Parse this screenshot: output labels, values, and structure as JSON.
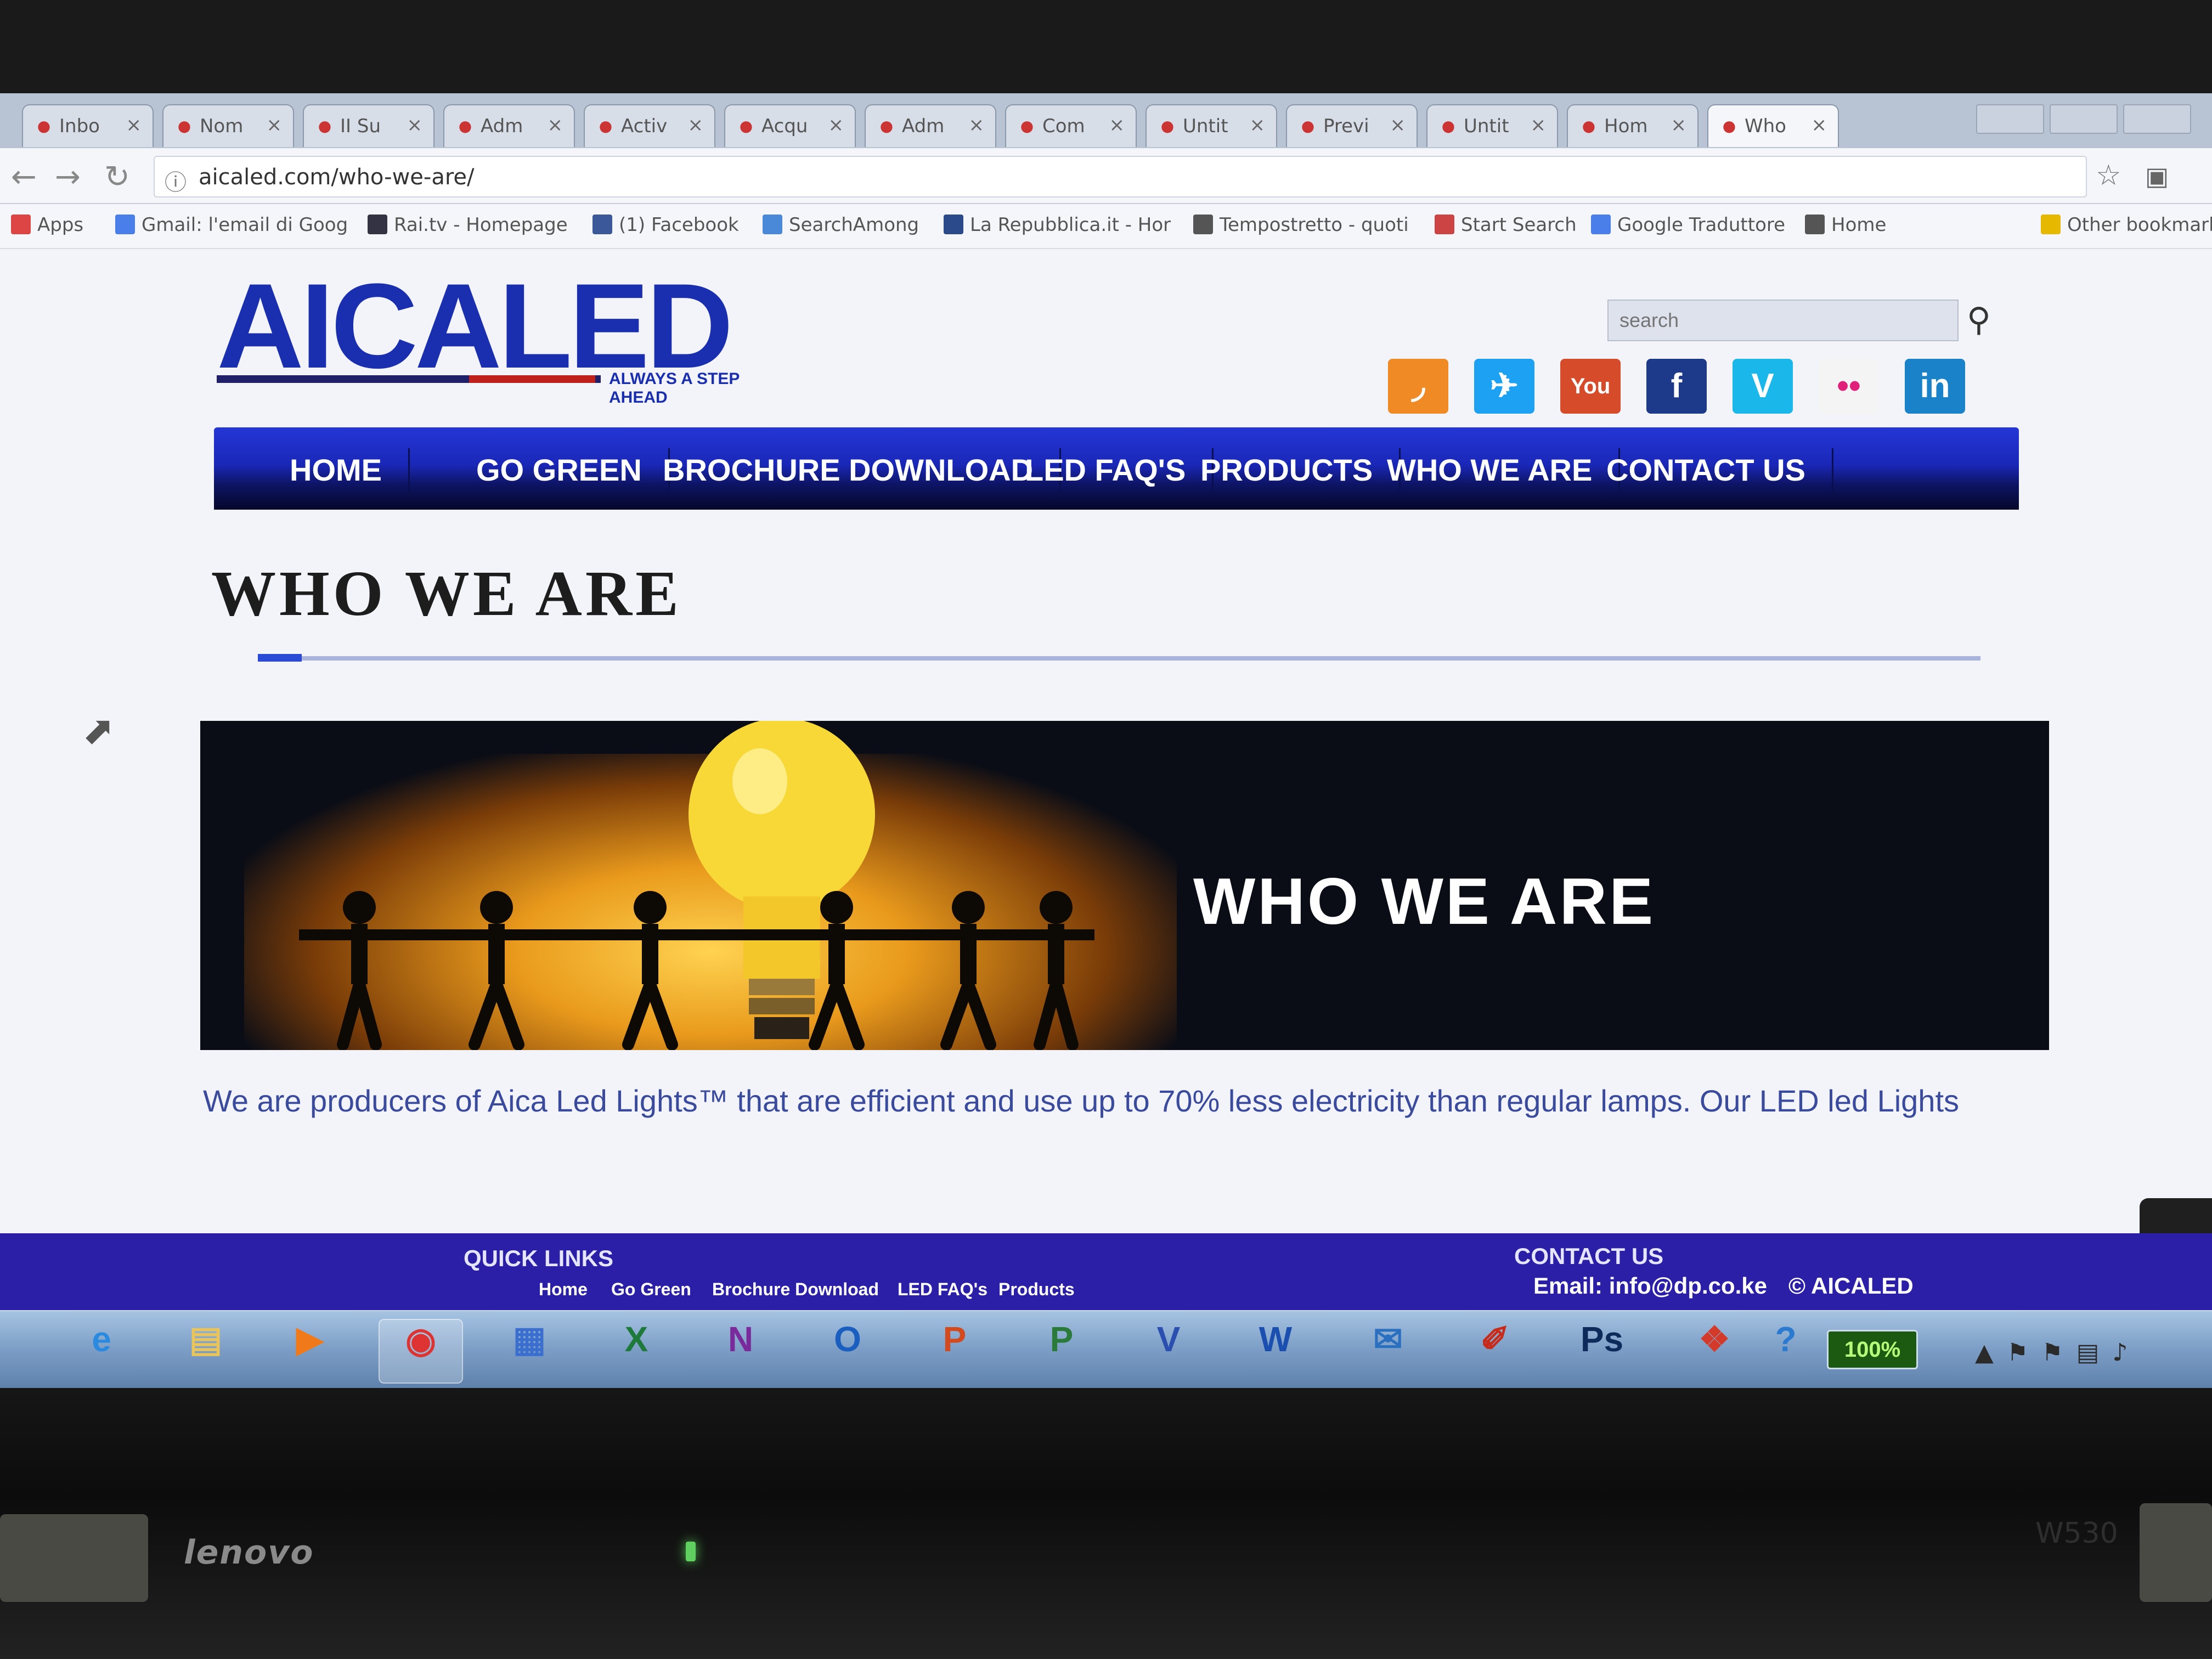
{
  "browser": {
    "tabs": [
      {
        "label": "Inbo",
        "favicon": "gmail-icon"
      },
      {
        "label": "Nom",
        "favicon": "generic-icon"
      },
      {
        "label": "II Su",
        "favicon": "google-icon"
      },
      {
        "label": "Adm",
        "favicon": "generic-icon"
      },
      {
        "label": "Activ",
        "favicon": "google-icon"
      },
      {
        "label": "Acqu",
        "favicon": "google-icon"
      },
      {
        "label": "Adm",
        "favicon": "generic-icon"
      },
      {
        "label": "Com",
        "favicon": "acrobat-icon"
      },
      {
        "label": "Untit",
        "favicon": "page-icon"
      },
      {
        "label": "Previ",
        "favicon": "google-icon"
      },
      {
        "label": "Untit",
        "favicon": "page-icon"
      },
      {
        "label": "Hom",
        "favicon": "page-icon"
      },
      {
        "label": "Who",
        "favicon": "document-icon"
      }
    ],
    "url": "aicaled.com/who-we-are/",
    "bookmarks": [
      {
        "label": "Apps",
        "color": "#d44"
      },
      {
        "label": "Gmail: l'email di Goog",
        "color": "#4a7ee8"
      },
      {
        "label": "Rai.tv - Homepage",
        "color": "#334"
      },
      {
        "label": "(1) Facebook",
        "color": "#3b5998"
      },
      {
        "label": "SearchAmong",
        "color": "#4a88d8"
      },
      {
        "label": "La Repubblica.it - Hor",
        "color": "#2a4a8a"
      },
      {
        "label": "Tempostretto - quoti",
        "color": "#555"
      },
      {
        "label": "Start Search",
        "color": "#c44"
      },
      {
        "label": "Google Traduttore",
        "color": "#4a7ee8"
      },
      {
        "label": "Home",
        "color": "#555"
      },
      {
        "label": "Other bookmark",
        "color": "#e6b800"
      }
    ]
  },
  "site": {
    "logo_text": "AICALED",
    "tagline": "ALWAYS A STEP AHEAD",
    "search_placeholder": "search",
    "social": [
      {
        "name": "rss",
        "symbol": "◞",
        "color": "#f08a24"
      },
      {
        "name": "twitter",
        "symbol": "✈",
        "color": "#1da1f2"
      },
      {
        "name": "youtube",
        "symbol": "You",
        "color": "#d64b2a"
      },
      {
        "name": "facebook",
        "symbol": "f",
        "color": "#1d3a8a"
      },
      {
        "name": "vimeo",
        "symbol": "V",
        "color": "#1ab7ea"
      },
      {
        "name": "flickr",
        "symbol": "••",
        "color": "#f4f4f4"
      },
      {
        "name": "linkedin",
        "symbol": "in",
        "color": "#1a82c8"
      }
    ],
    "nav": [
      "HOME",
      "GO GREEN",
      "BROCHURE DOWNLOAD",
      "LED FAQ'S",
      "PRODUCTS",
      "WHO WE ARE",
      "CONTACT US"
    ],
    "page_title": "WHO WE ARE",
    "banner_title": "WHO WE ARE",
    "intro": "We are producers of Aica Led Lights™ that are efficient and use up to 70% less electricity than regular lamps. Our LED led Lights"
  },
  "footer": {
    "quick_links_heading": "QUICK LINKS",
    "quick_links": [
      "Home",
      "Go Green",
      "Brochure Download",
      "LED FAQ's",
      "Products"
    ],
    "contact_heading": "CONTACT US",
    "email": "Email: info@dp.co.ke",
    "copyright": "© AICALED"
  },
  "taskbar": {
    "apps": [
      {
        "name": "internet-explorer",
        "glyph": "e",
        "color": "#2a8ae0"
      },
      {
        "name": "file-explorer",
        "glyph": "▤",
        "color": "#e8c45a"
      },
      {
        "name": "media-player",
        "glyph": "▶",
        "color": "#f07a1a"
      },
      {
        "name": "chrome",
        "glyph": "◉",
        "color": "#d33"
      },
      {
        "name": "outlook-calendar",
        "glyph": "▦",
        "color": "#3a6fd0"
      },
      {
        "name": "excel",
        "glyph": "X",
        "color": "#1e7a3a"
      },
      {
        "name": "onenote",
        "glyph": "N",
        "color": "#7a2a9a"
      },
      {
        "name": "outlook",
        "glyph": "O",
        "color": "#1a5fc0"
      },
      {
        "name": "powerpoint",
        "glyph": "P",
        "color": "#d24a1e"
      },
      {
        "name": "project",
        "glyph": "P",
        "color": "#2a7a3a"
      },
      {
        "name": "visio",
        "glyph": "V",
        "color": "#2a4fb0"
      },
      {
        "name": "word",
        "glyph": "W",
        "color": "#1a4fb0"
      },
      {
        "name": "thunderbird",
        "glyph": "✉",
        "color": "#2a6fc0"
      },
      {
        "name": "acrobat",
        "glyph": "✐",
        "color": "#c82a1a"
      },
      {
        "name": "photoshop",
        "glyph": "Ps",
        "color": "#0e2a5a"
      },
      {
        "name": "office-tools",
        "glyph": "❖",
        "color": "#d43a2a"
      },
      {
        "name": "help",
        "glyph": "?",
        "color": "#2a7ad0"
      }
    ],
    "battery": "100%"
  },
  "laptop": {
    "brand": "lenovo",
    "model": "W530"
  }
}
